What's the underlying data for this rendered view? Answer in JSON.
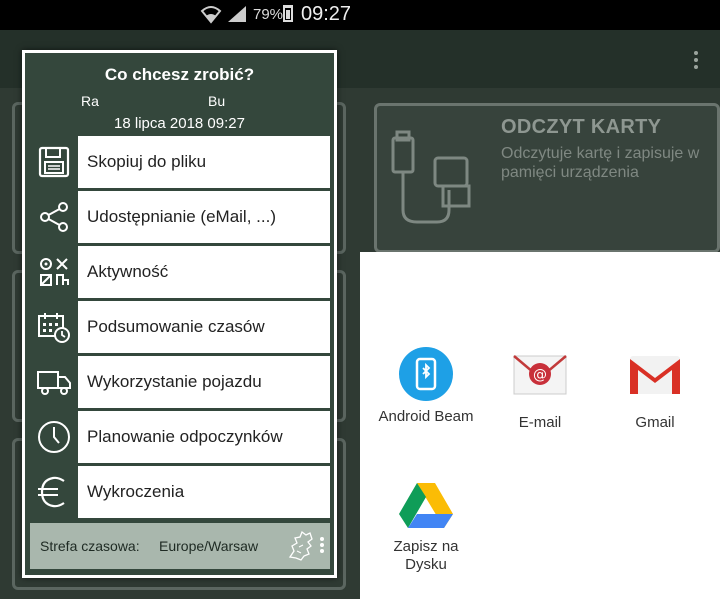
{
  "status_bar": {
    "battery": "79%",
    "time": "09:27"
  },
  "background": {
    "card_title": "ODCZYT KARTY",
    "card_desc": "Odczytuje kartę i zapisuje w pamięci urządzenia"
  },
  "dialog": {
    "title": "Co chcesz zrobić?",
    "sub_left": "Ra",
    "sub_right": "Bu",
    "date": "18 lipca 2018  09:27",
    "menu": [
      {
        "label": "Skopiuj do pliku",
        "icon": "floppy-disk-icon"
      },
      {
        "label": "Udostępnianie (eMail, ...)",
        "icon": "share-icon"
      },
      {
        "label": "Aktywność",
        "icon": "activity-icon"
      },
      {
        "label": "Podsumowanie czasów",
        "icon": "calendar-clock-icon"
      },
      {
        "label": "Wykorzystanie pojazdu",
        "icon": "truck-icon"
      },
      {
        "label": "Planowanie odpoczynków",
        "icon": "clock-icon"
      },
      {
        "label": "Wykroczenia",
        "icon": "euro-icon"
      }
    ],
    "timezone_label": "Strefa czasowa:",
    "timezone_value": "Europe/Warsaw"
  },
  "share_sheet": {
    "apps": [
      {
        "label": "Android Beam",
        "icon": "android-beam-icon"
      },
      {
        "label": "E-mail",
        "icon": "email-icon"
      },
      {
        "label": "Gmail",
        "icon": "gmail-icon"
      },
      {
        "label": "Zapisz na Dysku",
        "icon": "google-drive-icon"
      }
    ]
  },
  "colors": {
    "dialog_bg": "#34473c",
    "app_bg": "#2f3a33",
    "timezone_bar": "#a9b7ad",
    "gmail_red": "#d93025",
    "beam_blue": "#1ea0e6"
  }
}
